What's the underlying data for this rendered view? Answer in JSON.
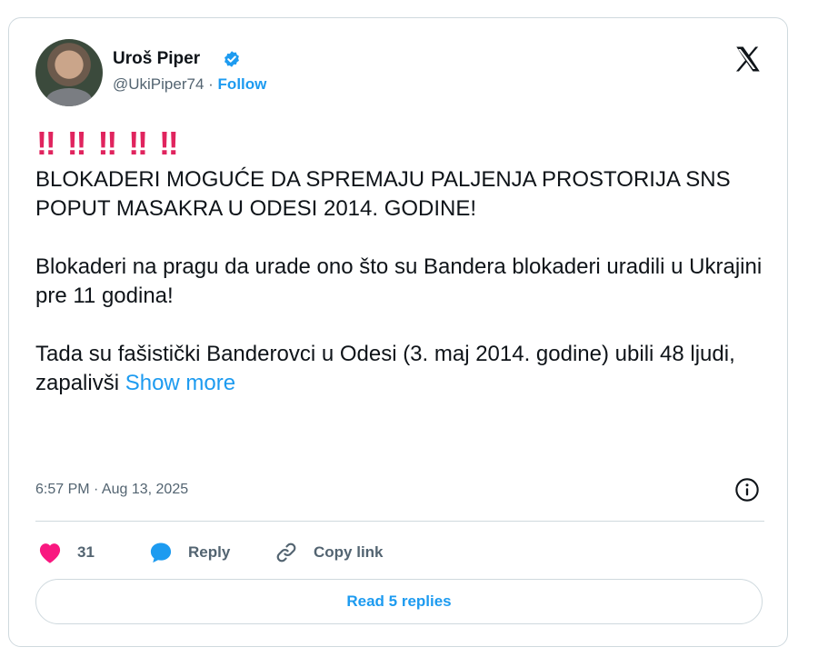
{
  "author": {
    "name": "Uroš Piper",
    "handle": "@UkiPiper74",
    "separator": "·",
    "follow_label": "Follow",
    "verified": true
  },
  "tweet": {
    "emphasis": "‼ ‼ ‼ ‼ ‼",
    "paragraphs": [
      "BLOKADERI MOGUĆE DA SPREMAJU PALJENJA PROSTORIJA SNS POPUT MASAKRA U ODESI 2014. GODINE!",
      "Blokaderi na pragu da urade ono što su Bandera blokaderi uradili u Ukrajini pre 11 godina!"
    ],
    "last_paragraph": "Tada su fašistički Banderovci u Odesi (3. maj 2014. godine) ubili 48 ljudi, zapalivši",
    "show_more": "Show more",
    "timestamp": "6:57 PM · Aug 13, 2025"
  },
  "actions": {
    "like_count": "31",
    "reply_label": "Reply",
    "copy_link_label": "Copy link"
  },
  "read_replies_label": "Read 5 replies",
  "colors": {
    "accent": "#1d9bf0",
    "like": "#f91880",
    "emphasis": "#e0245e",
    "muted": "#536471",
    "border": "#cfd9de"
  },
  "icons": [
    "verified-badge-icon",
    "x-logo-icon",
    "info-icon",
    "heart-icon",
    "reply-bubble-icon",
    "link-icon"
  ]
}
